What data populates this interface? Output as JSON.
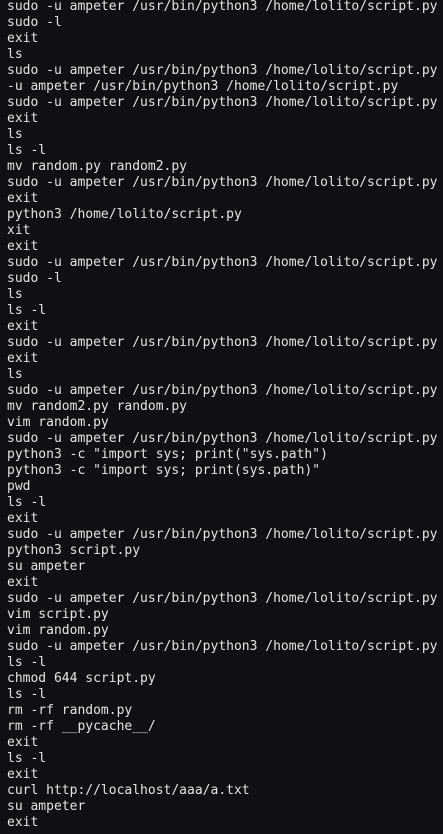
{
  "terminal": {
    "lines": [
      "sudo -u ampeter /usr/bin/python3 /home/lolito/script.py",
      "sudo -l",
      "exit",
      "ls",
      "sudo -u ampeter /usr/bin/python3 /home/lolito/script.py",
      "-u ampeter /usr/bin/python3 /home/lolito/script.py",
      "sudo -u ampeter /usr/bin/python3 /home/lolito/script.py",
      "exit",
      "ls",
      "ls -l",
      "mv random.py random2.py",
      "sudo -u ampeter /usr/bin/python3 /home/lolito/script.py",
      "exit",
      "python3 /home/lolito/script.py",
      "xit",
      "exit",
      "sudo -u ampeter /usr/bin/python3 /home/lolito/script.py",
      "sudo -l",
      "ls",
      "ls -l",
      "exit",
      "sudo -u ampeter /usr/bin/python3 /home/lolito/script.py",
      "exit",
      "ls",
      "sudo -u ampeter /usr/bin/python3 /home/lolito/script.py",
      "mv random2.py random.py",
      "vim random.py",
      "sudo -u ampeter /usr/bin/python3 /home/lolito/script.py",
      "python3 -c \"import sys; print(\"sys.path\")",
      "python3 -c \"import sys; print(sys.path)\"",
      "pwd",
      "ls -l",
      "exit",
      "sudo -u ampeter /usr/bin/python3 /home/lolito/script.py",
      "python3 script.py",
      "su ampeter",
      "exit",
      "sudo -u ampeter /usr/bin/python3 /home/lolito/script.py",
      "vim script.py",
      "vim random.py",
      "sudo -u ampeter /usr/bin/python3 /home/lolito/script.py",
      "ls -l",
      "chmod 644 script.py",
      "ls -l",
      "rm -rf random.py",
      "rm -rf __pycache__/",
      "exit",
      "ls -l",
      "exit",
      "curl http://localhost/aaa/a.txt",
      "su ampeter",
      "exit"
    ]
  }
}
